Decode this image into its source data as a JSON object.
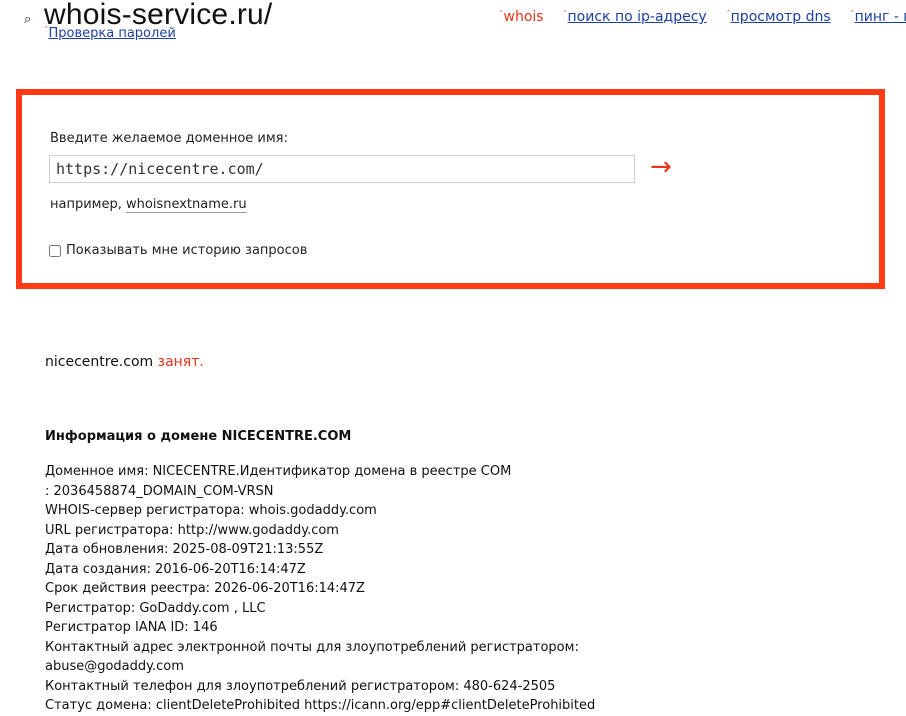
{
  "header": {
    "logo_icon": "search-icon",
    "logo": "whois-service.ru/",
    "subnav_link": "Проверка паролей"
  },
  "topnav": [
    {
      "label": "whois",
      "current": true
    },
    {
      "label": "поиск по ip-адресу",
      "current": false
    },
    {
      "label": "просмотр dns",
      "current": false
    },
    {
      "label": "пинг - по",
      "current": false
    }
  ],
  "search": {
    "prompt": "Введите желаемое доменное имя:",
    "value": "https://nicecentre.com/",
    "submit_icon": "arrow-right-icon",
    "example_prefix": "например,",
    "example_domain": "whoisnextname.ru",
    "history_label": "Показывать мне историю запросов",
    "history_checked": false
  },
  "result": {
    "domain": "nicecentre.com",
    "status": "занят."
  },
  "info": {
    "title": "Информация о домене NICECENTRE.COM",
    "lines": [
      "Доменное имя: NICECENTRE.Идентификатор домена в реестре COM",
      ": 2036458874_DOMAIN_COM-VRSN",
      "WHOIS-сервер регистратора: whois.godaddy.com",
      "URL регистратора: http://www.godaddy.com",
      "Дата обновления: 2025-08-09T21:13:55Z",
      "Дата создания: 2016-06-20T16:14:47Z",
      "Срок действия реестра: 2026-06-20T16:14:47Z",
      "Регистратор: GoDaddy.com , LLC",
      "Регистратор IANA ID: 146",
      "Контактный адрес электронной почты для злоупотреблений регистратором:",
      "abuse@godaddy.com",
      "Контактный телефон для злоупотреблений регистратором: 480-624-2505",
      "Статус домена: clientDeleteProhibited https://icann.org/epp#clientDeleteProhibited"
    ]
  },
  "colors": {
    "accent": "#e8331b",
    "box_border": "#ff3a14",
    "link": "#1d3fa3"
  }
}
